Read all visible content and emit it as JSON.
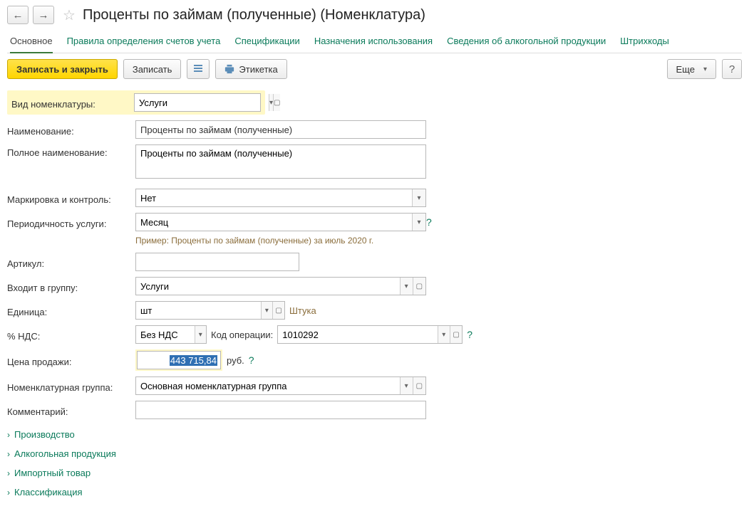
{
  "header": {
    "title": "Проценты по займам (полученные) (Номенклатура)"
  },
  "tabs": [
    {
      "label": "Основное",
      "active": true
    },
    {
      "label": "Правила определения счетов учета"
    },
    {
      "label": "Спецификации"
    },
    {
      "label": "Назначения использования"
    },
    {
      "label": "Сведения об алкогольной продукции"
    },
    {
      "label": "Штрихкоды"
    }
  ],
  "toolbar": {
    "save_close": "Записать и закрыть",
    "save": "Записать",
    "label_btn": "Этикетка",
    "more": "Еще"
  },
  "form": {
    "type_label": "Вид номенклатуры:",
    "type_value": "Услуги",
    "name_label": "Наименование:",
    "name_value": "Проценты по займам (полученные)",
    "fullname_label": "Полное наименование:",
    "fullname_value": "Проценты по займам (полученные)",
    "marking_label": "Маркировка и контроль:",
    "marking_value": "Нет",
    "period_label": "Периодичность услуги:",
    "period_value": "Месяц",
    "period_hint": "Пример: Проценты по займам (полученные) за июль 2020 г.",
    "article_label": "Артикул:",
    "article_value": "",
    "group_label": "Входит в группу:",
    "group_value": "Услуги",
    "unit_label": "Единица:",
    "unit_value": "шт",
    "unit_desc": "Штука",
    "vat_label": "% НДС:",
    "vat_value": "Без НДС",
    "opcode_label": "Код операции:",
    "opcode_value": "1010292",
    "price_label": "Цена продажи:",
    "price_value": "443 715,84",
    "price_unit": "руб.",
    "nomgroup_label": "Номенклатурная группа:",
    "nomgroup_value": "Основная номенклатурная группа",
    "comment_label": "Комментарий:",
    "comment_value": ""
  },
  "expanders": [
    "Производство",
    "Алкогольная продукция",
    "Импортный товар",
    "Классификация"
  ]
}
